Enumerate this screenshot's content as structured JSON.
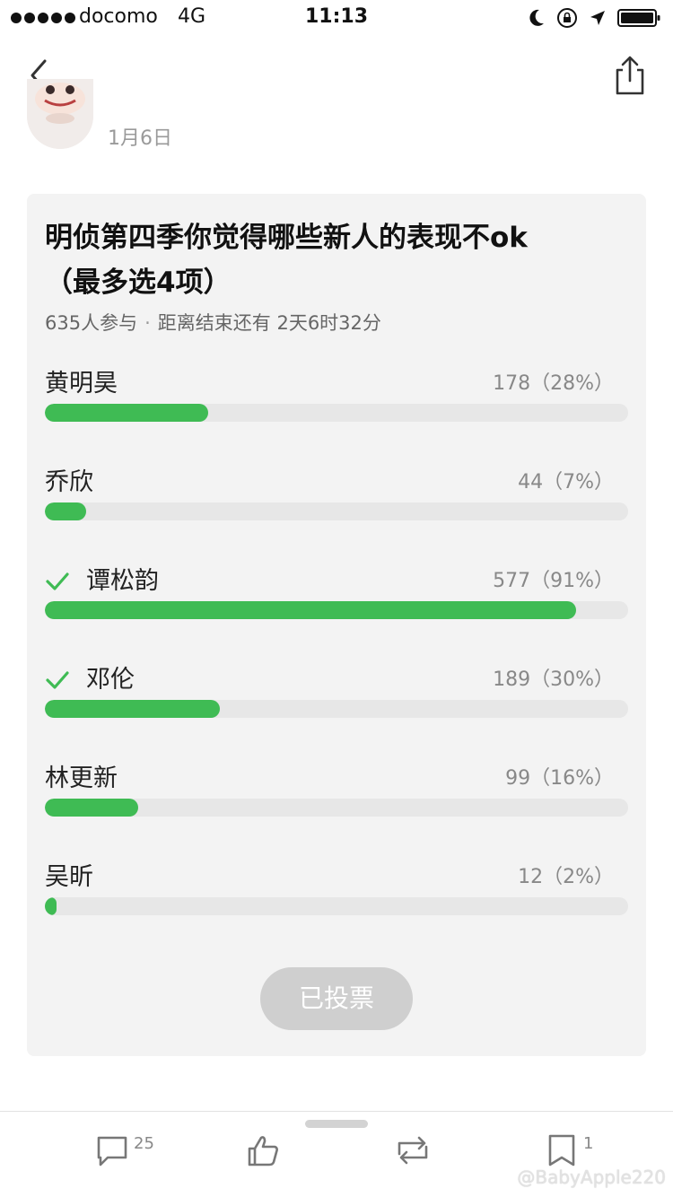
{
  "status_bar": {
    "carrier": "docomo",
    "network": "4G",
    "time": "11:13",
    "icons": [
      "moon-icon",
      "rotation-lock-icon",
      "location-arrow-icon",
      "battery-icon"
    ]
  },
  "nav": {
    "back_icon": "chevron-left-icon",
    "share_icon": "share-icon"
  },
  "post": {
    "date": "1月6日"
  },
  "poll": {
    "title": "明侦第四季你觉得哪些新人的表现不ok（最多选4项）",
    "participants": "635人参与",
    "separator": "·",
    "deadline": "距离结束还有 2天6时32分",
    "accent_color": "#3fbb54",
    "options": [
      {
        "name": "黄明昊",
        "count": "178（28%）",
        "fraction": 0.28,
        "checked": false
      },
      {
        "name": "乔欣",
        "count": "44（7%）",
        "fraction": 0.07,
        "checked": false
      },
      {
        "name": "谭松韵",
        "count": "577（91%）",
        "fraction": 0.91,
        "checked": true
      },
      {
        "name": "邓伦",
        "count": "189（30%）",
        "fraction": 0.3,
        "checked": true
      },
      {
        "name": "林更新",
        "count": "99（16%）",
        "fraction": 0.16,
        "checked": false
      },
      {
        "name": "吴昕",
        "count": "12（2%）",
        "fraction": 0.02,
        "checked": false
      }
    ],
    "voted_label": "已投票"
  },
  "toolbar": {
    "comment_count": "25",
    "bookmark_count": "1",
    "icons": [
      "comment-icon",
      "like-icon",
      "repost-icon",
      "bookmark-icon"
    ]
  },
  "watermark": "@BabyApple220"
}
